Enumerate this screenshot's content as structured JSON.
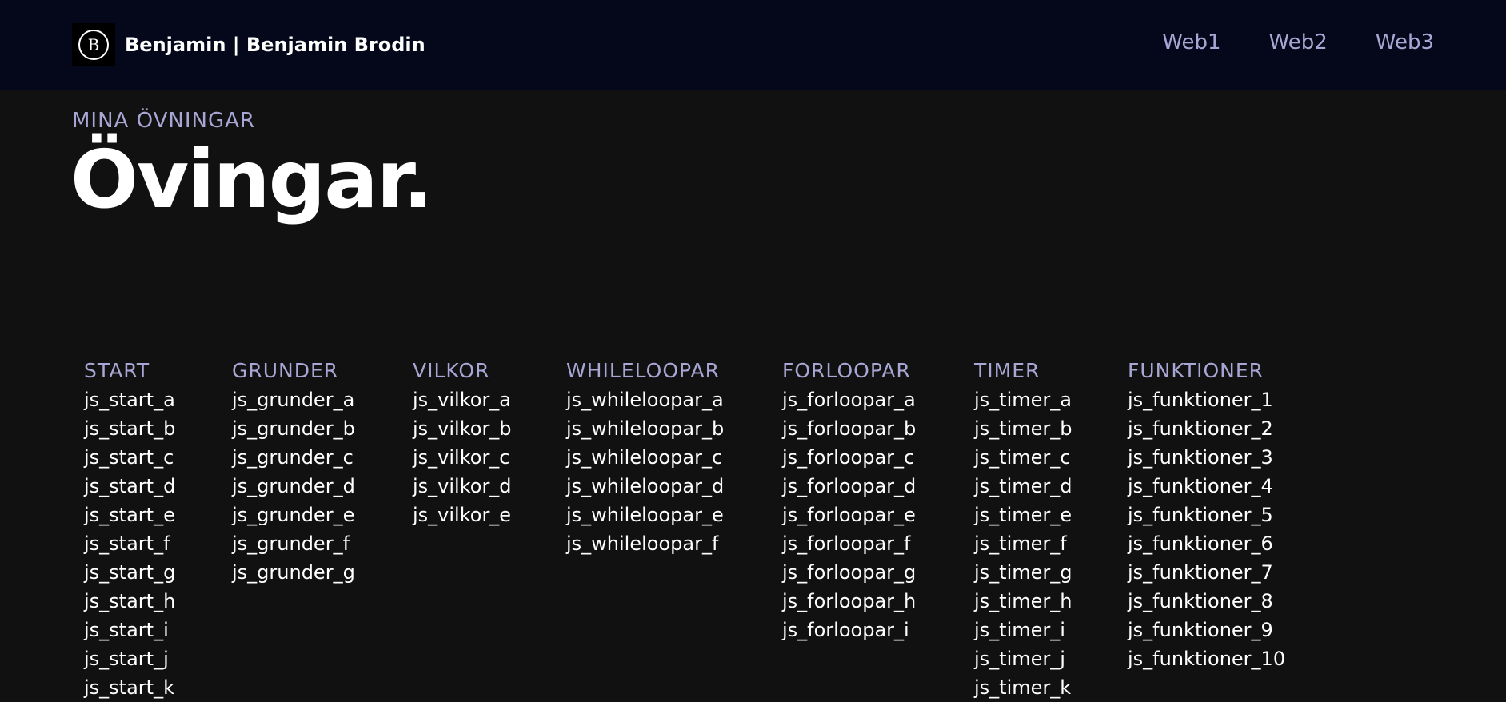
{
  "header": {
    "brand": "Benjamin | Benjamin Brodin",
    "logo_letter": "B",
    "nav": [
      "Web1",
      "Web2",
      "Web3"
    ]
  },
  "hero": {
    "subtitle": "MINA ÖVNINGAR",
    "title": "Övingar."
  },
  "sections": [
    {
      "title": "START",
      "links": [
        "js_start_a",
        "js_start_b",
        "js_start_c",
        "js_start_d",
        "js_start_e",
        "js_start_f",
        "js_start_g",
        "js_start_h",
        "js_start_i",
        "js_start_j",
        "js_start_k"
      ]
    },
    {
      "title": "GRUNDER",
      "links": [
        "js_grunder_a",
        "js_grunder_b",
        "js_grunder_c",
        "js_grunder_d",
        "js_grunder_e",
        "js_grunder_f",
        "js_grunder_g"
      ]
    },
    {
      "title": "VILKOR",
      "links": [
        "js_vilkor_a",
        "js_vilkor_b",
        "js_vilkor_c",
        "js_vilkor_d",
        "js_vilkor_e"
      ]
    },
    {
      "title": "WHILELOOPAR",
      "links": [
        "js_whileloopar_a",
        "js_whileloopar_b",
        "js_whileloopar_c",
        "js_whileloopar_d",
        "js_whileloopar_e",
        "js_whileloopar_f"
      ]
    },
    {
      "title": "FORLOOPAR",
      "links": [
        "js_forloopar_a",
        "js_forloopar_b",
        "js_forloopar_c",
        "js_forloopar_d",
        "js_forloopar_e",
        "js_forloopar_f",
        "js_forloopar_g",
        "js_forloopar_h",
        "js_forloopar_i"
      ]
    },
    {
      "title": "TIMER",
      "links": [
        "js_timer_a",
        "js_timer_b",
        "js_timer_c",
        "js_timer_d",
        "js_timer_e",
        "js_timer_f",
        "js_timer_g",
        "js_timer_h",
        "js_timer_i",
        "js_timer_j",
        "js_timer_k"
      ]
    },
    {
      "title": "FUNKTIONER",
      "links": [
        "js_funktioner_1",
        "js_funktioner_2",
        "js_funktioner_3",
        "js_funktioner_4",
        "js_funktioner_5",
        "js_funktioner_6",
        "js_funktioner_7",
        "js_funktioner_8",
        "js_funktioner_9",
        "js_funktioner_10"
      ]
    }
  ],
  "colors": {
    "nav_bg": "#05081a",
    "page_bg": "#111111",
    "accent": "#a8a6d4",
    "text": "#ffffff"
  }
}
